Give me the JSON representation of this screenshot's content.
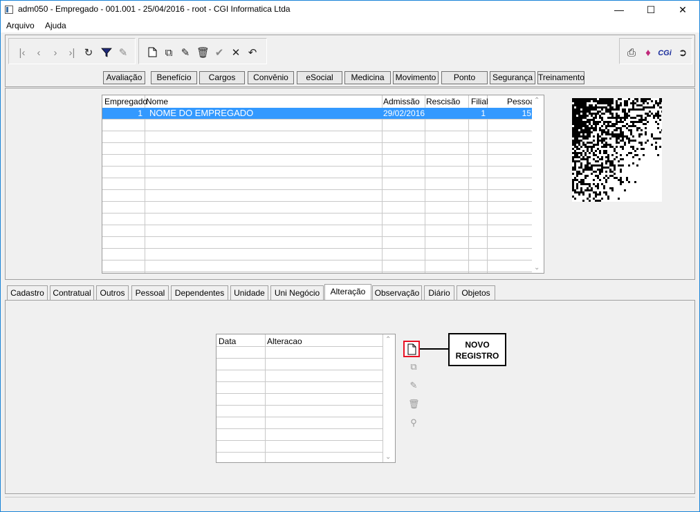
{
  "window": {
    "title": "adm050 - Empregado - 001.001 - 25/04/2016 - root - CGI Informatica Ltda",
    "minimize": "—",
    "maximize": "☐",
    "close": "✕"
  },
  "menu": [
    {
      "label": "Arquivo"
    },
    {
      "label": "Ajuda"
    }
  ],
  "toolbar": {
    "nav_icons": [
      "first-icon",
      "prev-icon",
      "next-icon",
      "last-icon",
      "refresh-icon",
      "filter-icon",
      "search-records-icon"
    ],
    "edit_icons": [
      "new-icon",
      "copy-icon",
      "edit-icon",
      "delete-icon",
      "confirm-icon",
      "cancel-icon",
      "undo-icon"
    ],
    "right_icons": [
      "print-icon",
      "book-icon",
      "cgi-icon",
      "exit-icon"
    ],
    "cgi_label": "CGi"
  },
  "modules": [
    "Avaliação",
    "Benefício",
    "Cargos",
    "Convênio",
    "eSocial",
    "Medicina",
    "Movimento",
    "Ponto",
    "Segurança",
    "Treinamento"
  ],
  "employee_grid": {
    "columns": [
      "Empregado",
      "Nome",
      "Admissão",
      "Rescisão",
      "Filial",
      "Pessoa"
    ],
    "rows": [
      {
        "empregado": "1",
        "nome": "NOME DO EMPREGADO",
        "admissao": "29/02/2016",
        "rescisao": "",
        "filial": "1",
        "pessoa": "15"
      }
    ]
  },
  "tabs": [
    "Cadastro",
    "Contratual",
    "Outros",
    "Pessoal",
    "Dependentes",
    "Unidade",
    "Uni Negócio",
    "Alteração",
    "Observação",
    "Diário",
    "Objetos"
  ],
  "active_tab": "Alteração",
  "change_grid": {
    "columns": [
      "Data",
      "Alteracao"
    ]
  },
  "side_actions": [
    "new-record-icon",
    "copy-icon",
    "edit-icon",
    "delete-icon",
    "search-icon"
  ],
  "callout": {
    "line1": "NOVO",
    "line2": "REGISTRO"
  },
  "colors": {
    "selection": "#3399ff",
    "highlight": "#e81123"
  }
}
